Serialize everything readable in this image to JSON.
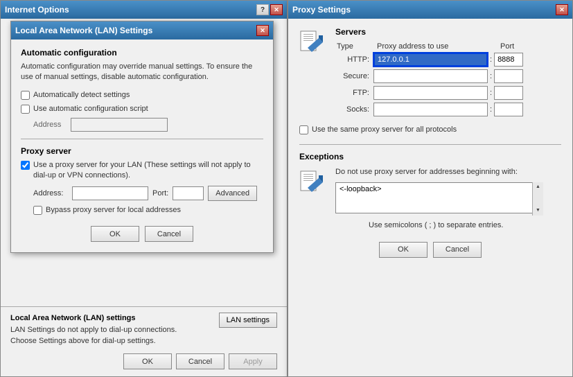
{
  "internet_options": {
    "title": "Internet Options",
    "buttons": {
      "help": "?",
      "close": "✕"
    }
  },
  "lan_dialog": {
    "title": "Local Area Network (LAN) Settings",
    "close_btn": "✕",
    "auto_config": {
      "title": "Automatic configuration",
      "desc": "Automatic configuration may override manual settings. To ensure the use of manual settings, disable automatic configuration.",
      "detect_label": "Automatically detect settings",
      "detect_checked": false,
      "script_label": "Use automatic configuration script",
      "script_checked": false,
      "address_label": "Address",
      "address_value": ""
    },
    "proxy_server": {
      "title": "Proxy server",
      "use_proxy_label": "Use a proxy server for your LAN (These settings will not apply to dial-up or VPN connections).",
      "use_proxy_checked": true,
      "address_label": "Address:",
      "address_value": "",
      "port_label": "Port:",
      "port_value": "",
      "advanced_label": "Advanced",
      "bypass_label": "Bypass proxy server for local addresses",
      "bypass_checked": false
    },
    "buttons": {
      "ok": "OK",
      "cancel": "Cancel"
    }
  },
  "internet_options_bottom": {
    "section_title": "Local Area Network (LAN) settings",
    "desc_line1": "LAN Settings do not apply to dial-up connections.",
    "desc_line2": "Choose Settings above for dial-up settings.",
    "lan_settings_btn": "LAN settings",
    "buttons": {
      "ok": "OK",
      "cancel": "Cancel",
      "apply": "Apply"
    }
  },
  "proxy_settings": {
    "title": "Proxy Settings",
    "close_btn": "✕",
    "servers": {
      "section_title": "Servers",
      "col_type": "Type",
      "col_address": "Proxy address to use",
      "col_port": "Port",
      "rows": [
        {
          "type": "HTTP:",
          "address": "127.0.0.1",
          "active": true,
          "colon": ":",
          "port": "8888"
        },
        {
          "type": "Secure:",
          "address": "",
          "active": false,
          "colon": ":",
          "port": ""
        },
        {
          "type": "FTP:",
          "address": "",
          "active": false,
          "colon": ":",
          "port": ""
        },
        {
          "type": "Socks:",
          "address": "",
          "active": false,
          "colon": ":",
          "port": ""
        }
      ],
      "same_proxy_label": "Use the same proxy server for all protocols",
      "same_proxy_checked": false
    },
    "exceptions": {
      "section_title": "Exceptions",
      "desc": "Do not use proxy server for addresses beginning with:",
      "value": "<-loopback>",
      "note": "Use semicolons ( ; ) to separate entries."
    },
    "buttons": {
      "ok": "OK",
      "cancel": "Cancel"
    }
  }
}
